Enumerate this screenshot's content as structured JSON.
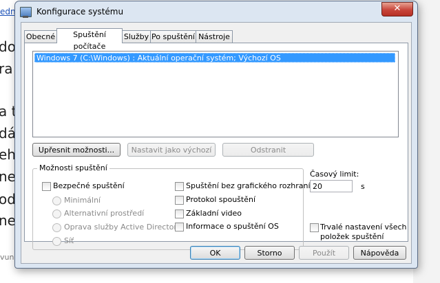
{
  "background": {
    "link_fragment": "edn",
    "text_fragments": [
      "do",
      "ra",
      "a t",
      "dá",
      "eh",
      "ne",
      "od",
      "ne"
    ],
    "small_fragment": "vun"
  },
  "window": {
    "title": "Konfigurace systému",
    "close_label": "✕"
  },
  "tabs": [
    {
      "label": "Obecné",
      "active": false
    },
    {
      "label": "Spuštění počítače",
      "active": true
    },
    {
      "label": "Služby",
      "active": false
    },
    {
      "label": "Po spuštění",
      "active": false
    },
    {
      "label": "Nástroje",
      "active": false
    }
  ],
  "boot_list": {
    "items": [
      "Windows 7 (C:\\Windows) : Aktuální operační systém; Výchozí OS"
    ],
    "selected_index": 0
  },
  "list_buttons": {
    "advanced": "Upřesnit možnosti...",
    "set_default": "Nastavit jako výchozí",
    "delete": "Odstranit"
  },
  "boot_options": {
    "title": "Možnosti spuštění",
    "safe_boot": {
      "label": "Bezpečné spuštění",
      "checked": false
    },
    "safe_boot_modes": [
      {
        "label": "Minimální",
        "enabled": false
      },
      {
        "label": "Alternativní prostředí",
        "enabled": false
      },
      {
        "label": "Oprava služby Active Directory",
        "enabled": false
      },
      {
        "label": "Síť",
        "enabled": false
      }
    ],
    "right_options": [
      {
        "label": "Spuštění bez grafického rozhraní",
        "checked": false
      },
      {
        "label": "Protokol spouštění",
        "checked": false
      },
      {
        "label": "Základní video",
        "checked": false
      },
      {
        "label": "Informace o spuštění OS",
        "checked": false
      }
    ]
  },
  "timeout": {
    "label": "Časový limit:",
    "value": "20",
    "unit": "s"
  },
  "permanent": {
    "label_line1": "Trvalé nastavení všech",
    "label_line2": "položek spuštění",
    "checked": false
  },
  "footer_buttons": {
    "ok": "OK",
    "cancel": "Storno",
    "apply": "Použít",
    "help": "Nápověda"
  }
}
